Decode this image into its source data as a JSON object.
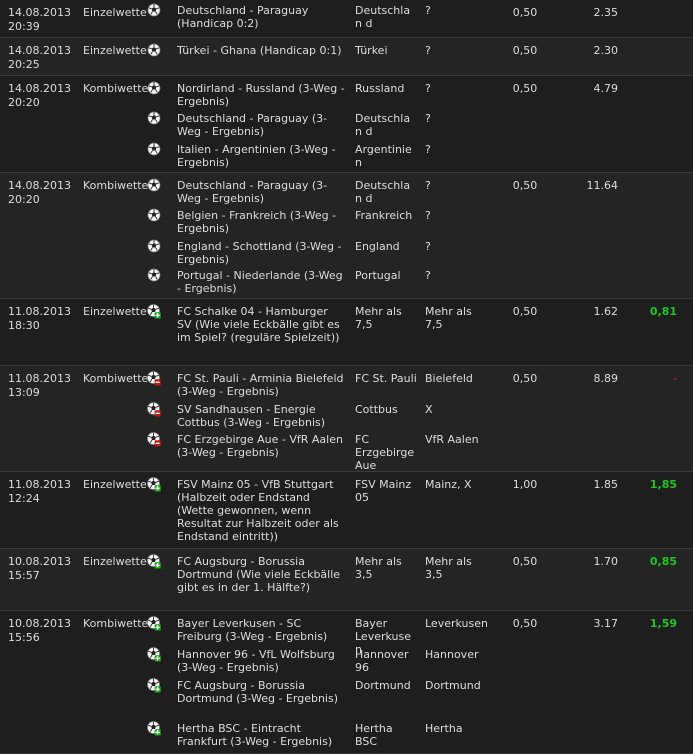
{
  "bets": [
    {
      "date": "14.08.2013\n20:39",
      "type": "Einzelwette",
      "stake": "0,50",
      "total": "2.35",
      "win": "",
      "winStatus": "",
      "legs": [
        {
          "match": "Deutschland - Paraguay (Handicap 0:2)",
          "tip": "Deutschlan d",
          "result": "?",
          "icon": "ball-icon"
        }
      ]
    },
    {
      "date": "14.08.2013\n20:25",
      "type": "Einzelwette",
      "stake": "0,50",
      "total": "2.30",
      "win": "",
      "winStatus": "",
      "legs": [
        {
          "match": "Türkei - Ghana (Handicap 0:1)",
          "tip": "Türkei",
          "result": "?",
          "icon": "ball-icon"
        }
      ]
    },
    {
      "date": "14.08.2013\n20:20",
      "type": "Kombiwette",
      "stake": "0,50",
      "total": "4.79",
      "win": "",
      "winStatus": "",
      "legs": [
        {
          "match": "Nordirland - Russland (3-Weg - Ergebnis)",
          "tip": "Russland",
          "result": "?",
          "icon": "ball-icon"
        },
        {
          "match": "Deutschland - Paraguay (3-Weg - Ergebnis)",
          "tip": "Deutschlan d",
          "result": "?",
          "icon": "ball-icon"
        },
        {
          "match": "Italien - Argentinien (3-Weg - Ergebnis)",
          "tip": "Argentinien",
          "result": "?",
          "icon": "ball-icon"
        }
      ]
    },
    {
      "date": "14.08.2013\n20:20",
      "type": "Kombiwette",
      "stake": "0,50",
      "total": "11.64",
      "win": "",
      "winStatus": "",
      "legs": [
        {
          "match": "Deutschland - Paraguay (3-Weg - Ergebnis)",
          "tip": "Deutschlan d",
          "result": "?",
          "icon": "ball-icon"
        },
        {
          "match": "Belgien - Frankreich (3-Weg - Ergebnis)",
          "tip": "Frankreich",
          "result": "?",
          "icon": "ball-icon"
        },
        {
          "match": "England - Schottland (3-Weg - Ergebnis)",
          "tip": "England",
          "result": "?",
          "icon": "ball-icon"
        },
        {
          "match": "Portugal - Niederlande (3-Weg - Ergebnis)",
          "tip": "Portugal",
          "result": "?",
          "icon": "ball-icon"
        }
      ]
    },
    {
      "date": "11.08.2013\n18:30",
      "type": "Einzelwette",
      "stake": "0,50",
      "total": "1.62",
      "win": "0,81",
      "winStatus": "won",
      "legs": [
        {
          "match": "FC Schalke 04 - Hamburger SV (Wie viele Eckbälle gibt es im Spiel? (reguläre Spielzeit))",
          "tip": "Mehr als 7,5",
          "result": "Mehr als 7,5",
          "icon": "won-icon"
        }
      ]
    },
    {
      "date": "11.08.2013\n13:09",
      "type": "Kombiwette",
      "stake": "0,50",
      "total": "8.89",
      "win": "-",
      "winStatus": "lost",
      "legs": [
        {
          "match": "FC St. Pauli - Arminia Bielefeld (3-Weg - Ergebnis)",
          "tip": "FC St. Pauli",
          "result": "Bielefeld",
          "icon": "lost-icon"
        },
        {
          "match": "SV Sandhausen - Energie Cottbus (3-Weg - Ergebnis)",
          "tip": "Cottbus",
          "result": "X",
          "icon": "lost-icon"
        },
        {
          "match": "FC Erzgebirge Aue - VfR Aalen (3-Weg - Ergebnis)",
          "tip": "FC Erzgebirge Aue",
          "result": "VfR Aalen",
          "icon": "lost-icon"
        }
      ]
    },
    {
      "date": "11.08.2013\n12:24",
      "type": "Einzelwette",
      "stake": "1,00",
      "total": "1.85",
      "win": "1,85",
      "winStatus": "won",
      "legs": [
        {
          "match": "FSV Mainz 05 - VfB Stuttgart (Halbzeit oder Endstand (Wette gewonnen, wenn Resultat zur Halbzeit oder als Endstand eintritt))",
          "tip": "FSV Mainz 05",
          "result": "Mainz, X",
          "icon": "won-icon"
        }
      ]
    },
    {
      "date": "10.08.2013\n15:57",
      "type": "Einzelwette",
      "stake": "0,50",
      "total": "1.70",
      "win": "0,85",
      "winStatus": "won",
      "legs": [
        {
          "match": "FC Augsburg - Borussia Dortmund (Wie viele Eckbälle gibt es in der 1. Hälfte?)",
          "tip": "Mehr als 3,5",
          "result": "Mehr als 3,5",
          "icon": "won-icon"
        }
      ]
    },
    {
      "date": "10.08.2013\n15:56",
      "type": "Kombiwette",
      "stake": "0,50",
      "total": "3.17",
      "win": "1,59",
      "winStatus": "won",
      "legs": [
        {
          "match": "Bayer Leverkusen - SC Freiburg (3-Weg - Ergebnis)",
          "tip": "Bayer Leverkusen",
          "result": "Leverkusen",
          "icon": "won-icon"
        },
        {
          "match": "Hannover 96 - VfL Wolfsburg (3-Weg - Ergebnis)",
          "tip": "Hannover 96",
          "result": "Hannover",
          "icon": "won-icon"
        },
        {
          "match": "FC Augsburg - Borussia Dortmund (3-Weg - Ergebnis)",
          "tip": "Dortmund",
          "result": "Dortmund",
          "icon": "won-icon"
        },
        {
          "match": "Hertha BSC - Eintracht Frankfurt (3-Weg - Ergebnis)",
          "tip": "Hertha BSC",
          "result": "Hertha",
          "icon": "won-icon"
        }
      ]
    }
  ]
}
